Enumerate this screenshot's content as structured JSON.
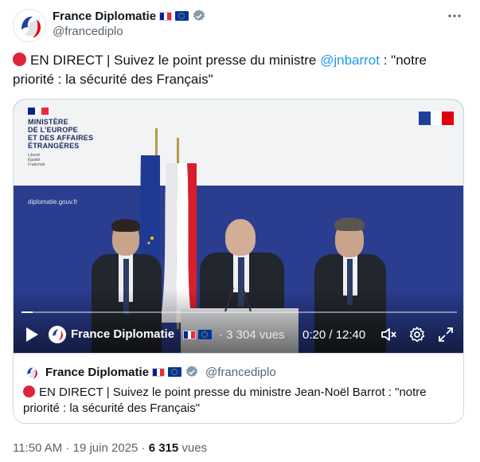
{
  "account": {
    "display_name": "France Diplomatie",
    "handle": "@francediplo",
    "flags": [
      "flag-fr-icon",
      "flag-eu-icon"
    ],
    "verified_icon": "verified-badge-icon"
  },
  "tweet": {
    "text_prefix": "EN DIRECT | Suivez le point presse du ministre ",
    "mention": "@jnbarrot",
    "text_suffix": " : \"notre priorité : la sécurité des Français\""
  },
  "video": {
    "ministry_lines": [
      "MINISTÈRE",
      "DE L'EUROPE",
      "ET DES AFFAIRES",
      "ÉTRANGÈRES"
    ],
    "motto": [
      "Liberté",
      "Égalité",
      "Fraternité"
    ],
    "site_url": "diplomatie.gouv.fr",
    "progress": 0.026,
    "channel_name": "France Diplomatie",
    "views": "· 3 304 vues",
    "time": "0:20 / 12:40"
  },
  "quote": {
    "display_name": "France Diplomatie",
    "handle": "@francediplo",
    "text": "EN DIRECT | Suivez le point presse du ministre Jean-Noël Barrot : \"notre priorité : la sécurité des Français\""
  },
  "meta": {
    "time": "11:50 AM",
    "separator1": " · ",
    "date": "19 juin 2025",
    "separator2": " · ",
    "views_count": "6 315",
    "views_label": " vues"
  },
  "colors": {
    "accent": "#1d9bf0",
    "live_red": "#e0233c",
    "france_blue": "#002395",
    "france_red": "#ed2939"
  }
}
